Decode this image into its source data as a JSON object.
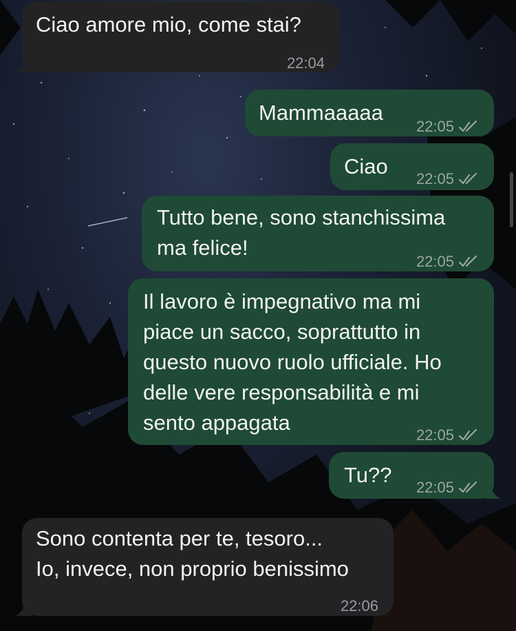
{
  "chat": {
    "messages": [
      {
        "direction": "incoming",
        "lines": [
          "Ciao amore mio, come stai?"
        ],
        "time": "22:04"
      },
      {
        "direction": "outgoing",
        "lines": [
          "Mammaaaaa"
        ],
        "time": "22:05",
        "status_icon": "double-check-icon"
      },
      {
        "direction": "outgoing",
        "lines": [
          "Ciao"
        ],
        "time": "22:05",
        "status_icon": "double-check-icon"
      },
      {
        "direction": "outgoing",
        "lines": [
          "Tutto bene, sono stanchissima",
          "ma felice!"
        ],
        "time": "22:05",
        "status_icon": "double-check-icon"
      },
      {
        "direction": "outgoing",
        "lines": [
          "Il lavoro è impegnativo ma mi",
          "piace un sacco, soprattutto in",
          "questo nuovo ruolo ufficiale. Ho",
          "delle vere responsabilità e mi",
          "sento appagata"
        ],
        "time": "22:05",
        "status_icon": "double-check-icon"
      },
      {
        "direction": "outgoing",
        "lines": [
          "Tu??"
        ],
        "time": "22:05",
        "status_icon": "double-check-icon"
      },
      {
        "direction": "incoming",
        "lines": [
          "Sono contenta per te, tesoro...",
          "Io, invece, non proprio benissimo"
        ],
        "time": "22:06"
      }
    ]
  },
  "colors": {
    "incoming_bubble": "#232325",
    "outgoing_bubble": "#1f4a35",
    "text": "#f2f2f2",
    "timestamp": "#9aa7a0"
  }
}
